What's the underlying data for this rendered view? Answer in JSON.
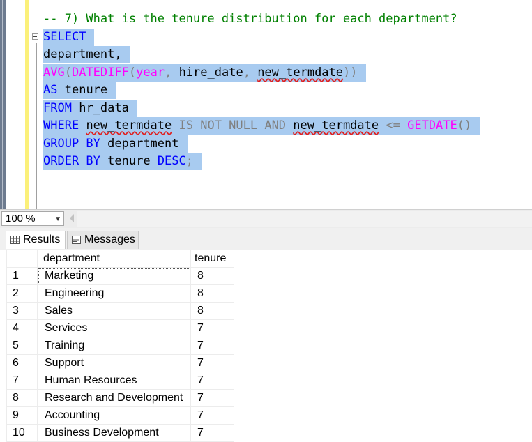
{
  "editor": {
    "comment": "-- 7) What is the tenure distribution for each department?",
    "line_select": "SELECT",
    "line_department": "department,",
    "avg_fn": "AVG",
    "avg_open": "(",
    "datediff_fn": "DATEDIFF",
    "datediff_open": "(",
    "year_arg": "year",
    "comma1": ",",
    "hire_date": "hire_date",
    "comma2": ",",
    "new_termdate_1": "new_termdate",
    "close_parens": "))",
    "as_kw": "AS",
    "tenure_alias": "tenure",
    "from_kw": "FROM",
    "table_name": "hr_data",
    "where_kw": "WHERE",
    "new_termdate_2": "new_termdate",
    "is_not_null": "IS NOT NULL AND",
    "new_termdate_3": "new_termdate",
    "lte": "<=",
    "getdate_fn": "GETDATE",
    "getdate_parens": "()",
    "group_by_kw": "GROUP BY",
    "group_col": "department",
    "order_by_kw": "ORDER BY",
    "order_col": "tenure",
    "desc_kw": "DESC",
    "semicolon": ";"
  },
  "zoom": {
    "value": "100 %"
  },
  "tabs": [
    {
      "label": "Results",
      "icon": "grid-icon"
    },
    {
      "label": "Messages",
      "icon": "messages-icon"
    }
  ],
  "grid": {
    "columns": [
      "department",
      "tenure"
    ],
    "rows": [
      {
        "num": "1",
        "department": "Marketing",
        "tenure": "8"
      },
      {
        "num": "2",
        "department": "Engineering",
        "tenure": "8"
      },
      {
        "num": "3",
        "department": "Sales",
        "tenure": "8"
      },
      {
        "num": "4",
        "department": "Services",
        "tenure": "7"
      },
      {
        "num": "5",
        "department": "Training",
        "tenure": "7"
      },
      {
        "num": "6",
        "department": "Support",
        "tenure": "7"
      },
      {
        "num": "7",
        "department": "Human Resources",
        "tenure": "7"
      },
      {
        "num": "8",
        "department": "Research and Development",
        "tenure": "7"
      },
      {
        "num": "9",
        "department": "Accounting",
        "tenure": "7"
      },
      {
        "num": "10",
        "department": "Business Development",
        "tenure": "7"
      }
    ]
  },
  "colors": {
    "keyword": "#0000ff",
    "function": "#ff00ff",
    "operator": "#808080",
    "comment": "#008000",
    "selection": "#a8cbf0",
    "change_bar": "#fbf07a"
  }
}
